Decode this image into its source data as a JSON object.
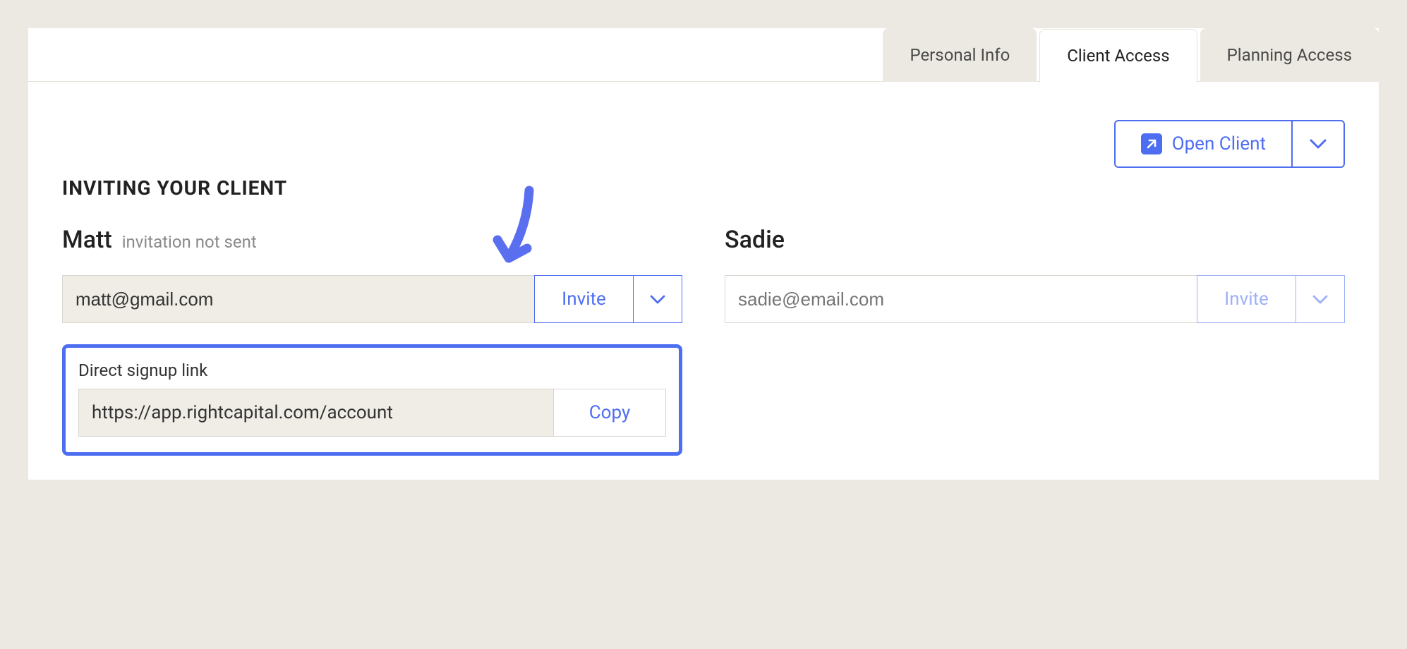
{
  "tabs": [
    {
      "label": "Personal Info",
      "active": false
    },
    {
      "label": "Client Access",
      "active": true
    },
    {
      "label": "Planning Access",
      "active": false
    }
  ],
  "open_client": {
    "label": "Open Client"
  },
  "section_heading": "INVITING YOUR CLIENT",
  "clients": {
    "left": {
      "name": "Matt",
      "status": "invitation not sent",
      "email": "matt@gmail.com",
      "email_filled": true,
      "invite_label": "Invite",
      "signup": {
        "label": "Direct signup link",
        "url": "https://app.rightcapital.com/account",
        "copy_label": "Copy"
      }
    },
    "right": {
      "name": "Sadie",
      "status": "",
      "email_placeholder": "sadie@email.com",
      "invite_label": "Invite"
    }
  },
  "colors": {
    "accent": "#4e6ef2",
    "bg": "#ece9e2",
    "muted": "#8a8a8a"
  }
}
